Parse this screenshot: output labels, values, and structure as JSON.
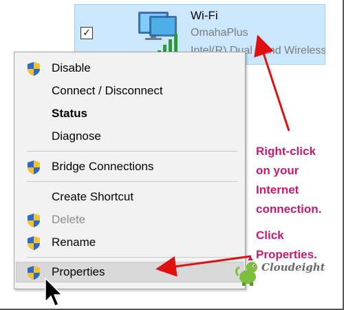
{
  "adapter": {
    "name": "Wi-Fi",
    "ssid": "OmahaPlus",
    "device": "Intel(R) Dual Band Wireless-AC",
    "checked": "✓",
    "icon": "wifi-network-adapter-icon"
  },
  "menu": {
    "items": [
      {
        "label": "Disable",
        "icon": "uac-shield-icon"
      },
      {
        "label": "Connect / Disconnect"
      },
      {
        "label": "Status",
        "bold": true
      },
      {
        "label": "Diagnose"
      },
      {
        "label": "Bridge Connections",
        "icon": "uac-shield-icon"
      },
      {
        "label": "Create Shortcut"
      },
      {
        "label": "Delete",
        "icon": "uac-shield-icon",
        "disabled": true
      },
      {
        "label": "Rename",
        "icon": "uac-shield-icon"
      },
      {
        "label": "Properties",
        "icon": "uac-shield-icon",
        "highlighted": true
      }
    ]
  },
  "annotation": {
    "lines": [
      "Right-click",
      "on your",
      "Internet",
      "connection."
    ],
    "lines2": [
      "Click",
      "Properties."
    ],
    "color": "#c8196e"
  },
  "branding": {
    "logo_text": "Cloudeight"
  },
  "colors": {
    "arrow": "#e01010",
    "selection": "#cce8ff",
    "menu_bg": "#f2f2f2"
  }
}
